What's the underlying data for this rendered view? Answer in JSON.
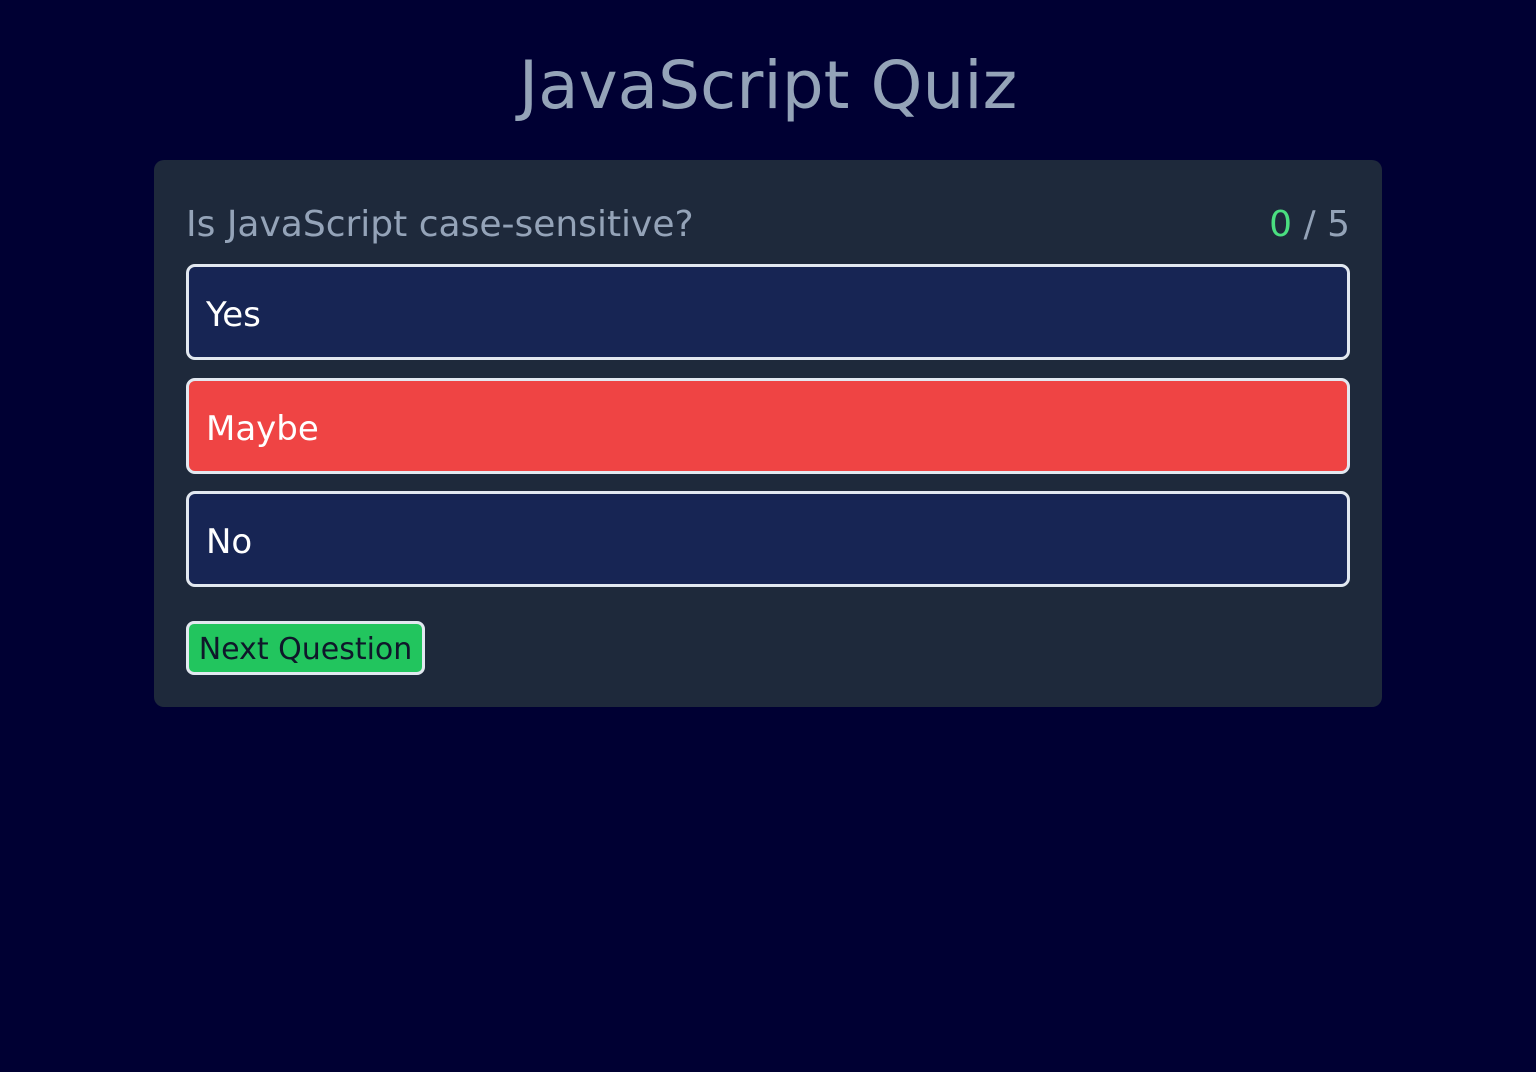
{
  "page": {
    "title": "JavaScript Quiz"
  },
  "quiz": {
    "question": "Is JavaScript case-sensitive?",
    "score": {
      "current": "0",
      "separator": " / ",
      "total": "5"
    },
    "answers": [
      {
        "label": "Yes",
        "state": "default"
      },
      {
        "label": "Maybe",
        "state": "selected-wrong"
      },
      {
        "label": "No",
        "state": "default"
      }
    ],
    "next_label": "Next Question"
  },
  "colors": {
    "background": "#000033",
    "card": "#1e293b",
    "answer_default": "#172554",
    "answer_wrong": "#ef4444",
    "score_correct": "#4ade80",
    "next_button": "#22c55e"
  }
}
